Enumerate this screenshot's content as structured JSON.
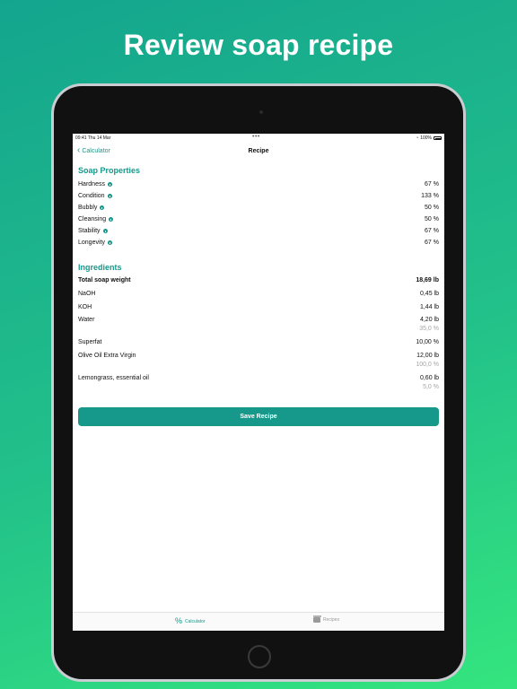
{
  "headline": "Review soap recipe",
  "status": {
    "time": "09:41  Thu 14 Mar",
    "battery": "100%"
  },
  "nav": {
    "back_label": "Calculator",
    "title": "Recipe"
  },
  "properties": {
    "title": "Soap Properties",
    "items": [
      {
        "label": "Hardness",
        "value": "67 %"
      },
      {
        "label": "Condition",
        "value": "133 %"
      },
      {
        "label": "Bubbly",
        "value": "50 %"
      },
      {
        "label": "Cleansing",
        "value": "50 %"
      },
      {
        "label": "Stability",
        "value": "67 %"
      },
      {
        "label": "Longevity",
        "value": "67 %"
      }
    ]
  },
  "ingredients": {
    "title": "Ingredients",
    "total": {
      "label": "Total soap weight",
      "value": "18,69 lb"
    },
    "naoh": {
      "label": "NaOH",
      "value": "0,45 lb"
    },
    "koh": {
      "label": "KOH",
      "value": "1,44 lb"
    },
    "water": {
      "label": "Water",
      "value": "4,20 lb",
      "sub": "35,0 %"
    },
    "superfat": {
      "label": "Superfat",
      "value": "10,00 %"
    },
    "olive": {
      "label": "Olive Oil Extra Virgin",
      "value": "12,00 lb",
      "sub": "100,0 %"
    },
    "lemongrass": {
      "label": "Lemongrass, essential oil",
      "value": "0,60 lb",
      "sub": "5,0 %"
    }
  },
  "save_label": "Save Recipe",
  "tabs": {
    "calculator": "Calculator",
    "recipes": "Recipes"
  },
  "colors": {
    "accent": "#16998a"
  }
}
